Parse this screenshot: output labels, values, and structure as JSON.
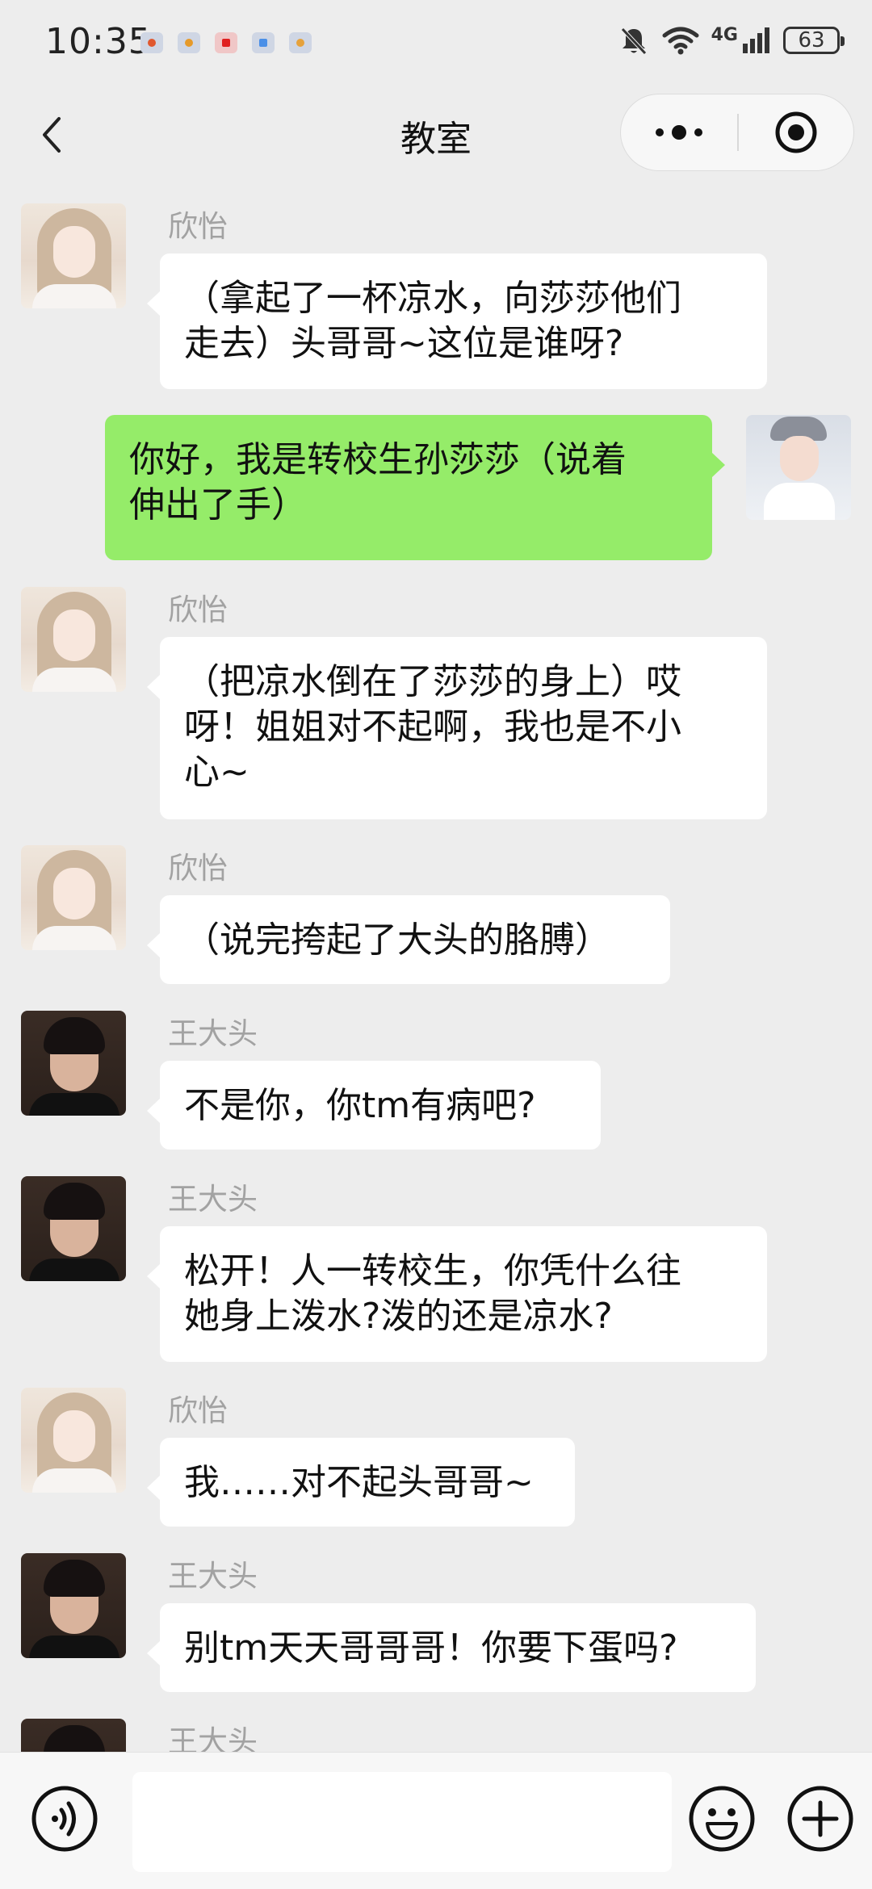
{
  "status_bar": {
    "time": "10:35",
    "network": "4G",
    "battery": "63",
    "notification_icons": [
      "app-notification-icon",
      "app-notification-icon",
      "app-notification-icon",
      "app-notification-icon",
      "app-notification-icon"
    ]
  },
  "header": {
    "title": "教室",
    "back_icon": "chevron-left-icon",
    "more_icon": "more-dots-icon",
    "close_icon": "target-close-icon"
  },
  "messages": [
    {
      "side": "left",
      "sender": "欣怡",
      "lines": [
        "（拿起了一杯凉水，向莎莎他们",
        "走去）头哥哥~这位是谁呀?"
      ]
    },
    {
      "side": "right",
      "lines": [
        "你好，我是转校生孙莎莎（说着",
        "伸出了手）"
      ]
    },
    {
      "side": "left",
      "sender": "欣怡",
      "lines": [
        "（把凉水倒在了莎莎的身上）哎",
        "呀！姐姐对不起啊，我也是不小",
        "心~"
      ]
    },
    {
      "side": "left",
      "sender": "欣怡",
      "lines": [
        "（说完挎起了大头的胳膊）"
      ]
    },
    {
      "side": "left",
      "sender": "王大头",
      "lines": [
        "不是你，你tm有病吧?"
      ]
    },
    {
      "side": "left",
      "sender": "王大头",
      "lines": [
        "松开！人一转校生，你凭什么往",
        "她身上泼水?泼的还是凉水?"
      ]
    },
    {
      "side": "left",
      "sender": "欣怡",
      "lines": [
        "我……对不起头哥哥~"
      ]
    },
    {
      "side": "left",
      "sender": "王大头",
      "lines": [
        "别tm天天哥哥哥！你要下蛋吗?"
      ]
    },
    {
      "side": "left",
      "sender": "王大头",
      "lines": []
    }
  ],
  "input_bar": {
    "voice_icon": "voice-icon",
    "input_value": "",
    "emoji_icon": "emoji-icon",
    "plus_icon": "plus-icon"
  },
  "colors": {
    "background": "#ededed",
    "bubble_other": "#ffffff",
    "bubble_self": "#95ec69",
    "sender_name": "#a2a2a2"
  }
}
